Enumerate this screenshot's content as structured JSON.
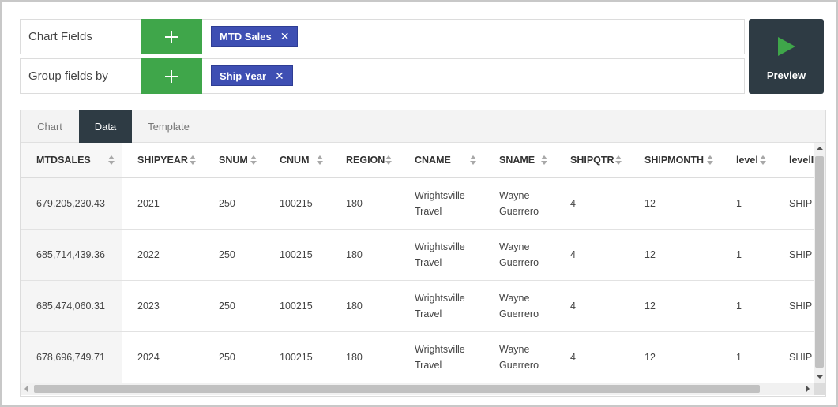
{
  "fields": {
    "chart_fields_label": "Chart Fields",
    "chart_fields_chips": [
      "MTD Sales"
    ],
    "group_by_label": "Group fields by",
    "group_by_chips": [
      "Ship Year"
    ],
    "chip_remove_symbol": "✕"
  },
  "preview": {
    "label": "Preview"
  },
  "tabs": [
    {
      "label": "Chart",
      "active": false
    },
    {
      "label": "Data",
      "active": true
    },
    {
      "label": "Template",
      "active": false
    }
  ],
  "table": {
    "columns": [
      "MTDSALES",
      "SHIPYEAR",
      "SNUM",
      "CNUM",
      "REGION",
      "CNAME",
      "SNAME",
      "SHIPQTR",
      "SHIPMONTH",
      "level",
      "levelI"
    ],
    "rows": [
      [
        "679,205,230.43",
        "2021",
        "250",
        "100215",
        "180",
        "Wrightsville Travel",
        "Wayne Guerrero",
        "4",
        "12",
        "1",
        "SHIP"
      ],
      [
        "685,714,439.36",
        "2022",
        "250",
        "100215",
        "180",
        "Wrightsville Travel",
        "Wayne Guerrero",
        "4",
        "12",
        "1",
        "SHIP"
      ],
      [
        "685,474,060.31",
        "2023",
        "250",
        "100215",
        "180",
        "Wrightsville Travel",
        "Wayne Guerrero",
        "4",
        "12",
        "1",
        "SHIP"
      ],
      [
        "678,696,749.71",
        "2024",
        "250",
        "100215",
        "180",
        "Wrightsville Travel",
        "Wayne Guerrero",
        "4",
        "12",
        "1",
        "SHIP"
      ]
    ]
  },
  "colors": {
    "add_button": "#3fa64a",
    "chip": "#3e4fb3",
    "preview_button": "#2e3b44",
    "preview_play": "#3fa64a",
    "active_tab": "#2e3b44"
  },
  "icons": {
    "add": "plus-icon",
    "remove": "close-icon",
    "preview": "play-icon",
    "sort": "sort-icon"
  }
}
